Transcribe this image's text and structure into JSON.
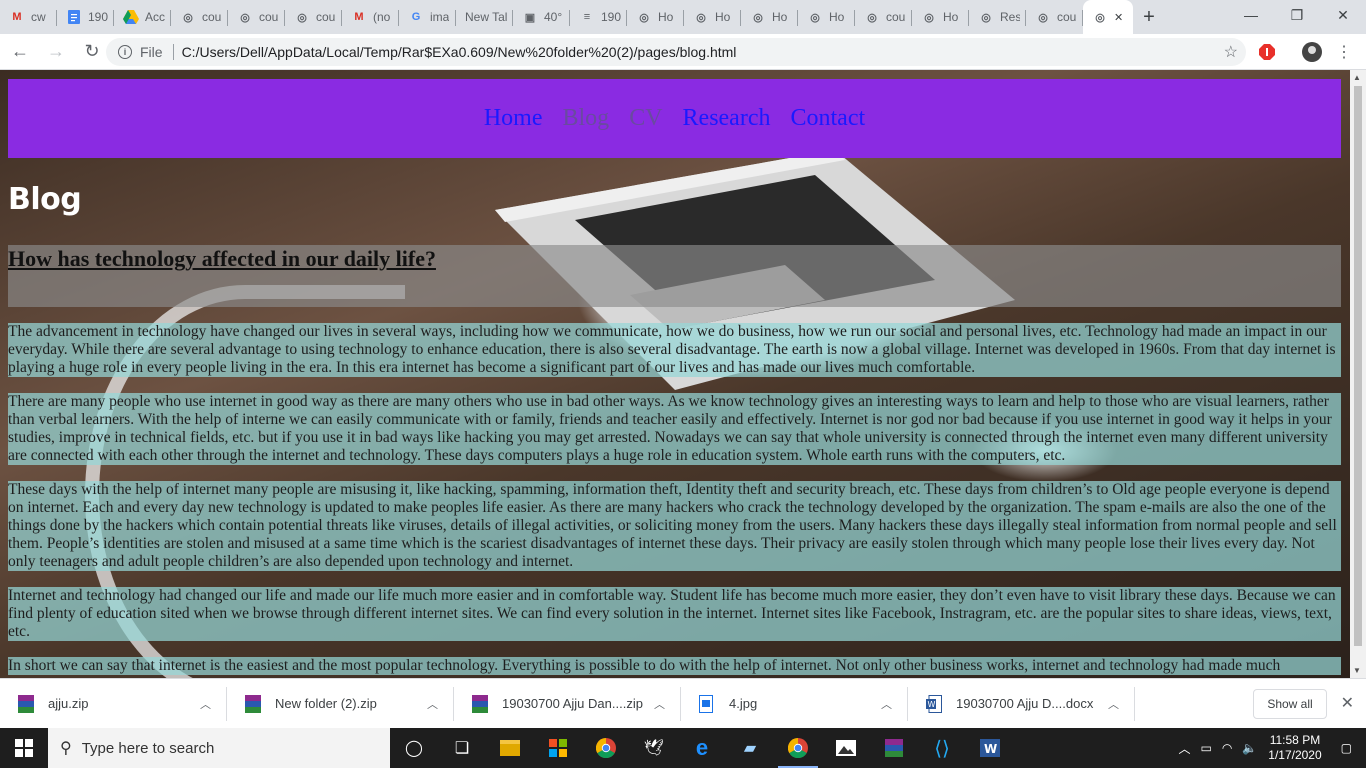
{
  "tabs": [
    {
      "title": "cw",
      "icon": "gmail-icon"
    },
    {
      "title": "190",
      "icon": "docs-icon"
    },
    {
      "title": "Acc",
      "icon": "drive-icon"
    },
    {
      "title": "cou",
      "icon": "globe-icon"
    },
    {
      "title": "cou",
      "icon": "globe-icon"
    },
    {
      "title": "cou",
      "icon": "globe-icon"
    },
    {
      "title": "(no",
      "icon": "gmail-icon"
    },
    {
      "title": "ima",
      "icon": "google-icon"
    },
    {
      "title": "New Tal",
      "icon": "none"
    },
    {
      "title": "40°",
      "icon": "weather-icon"
    },
    {
      "title": "190",
      "icon": "doc-icon"
    },
    {
      "title": "Ho",
      "icon": "globe-icon"
    },
    {
      "title": "Ho",
      "icon": "globe-icon"
    },
    {
      "title": "Ho",
      "icon": "globe-icon"
    },
    {
      "title": "Ho",
      "icon": "globe-icon"
    },
    {
      "title": "cou",
      "icon": "globe-icon"
    },
    {
      "title": "Ho",
      "icon": "globe-icon"
    },
    {
      "title": "Res",
      "icon": "globe-icon"
    },
    {
      "title": "cou",
      "icon": "globe-icon"
    }
  ],
  "address": {
    "scheme_label": "File",
    "url": "C:/Users/Dell/AppData/Local/Temp/Rar$EXa0.609/New%20folder%20(2)/pages/blog.html"
  },
  "page": {
    "nav": [
      {
        "label": "Home",
        "state": "link"
      },
      {
        "label": "Blog",
        "state": "visited"
      },
      {
        "label": "CV",
        "state": "visited"
      },
      {
        "label": "Research",
        "state": "link"
      },
      {
        "label": "Contact",
        "state": "link"
      }
    ],
    "title": "Blog",
    "question": "How has technology affected in our daily life?",
    "paragraphs": [
      "The advancement in technology have changed our lives in several ways, including how we communicate, how we do business, how we run our social and personal lives, etc. Technology had made an impact in our everyday. While there are several advantage to using technology to enhance education, there is also several disadvantage. The earth is now a global village. Internet was developed in 1960s. From that day internet is playing a huge role in every people living in the era. In this era internet has become a significant part of our lives and has made our lives much comfortable.",
      "There are many people who use internet in good way as there are many others who use in bad other ways. As we know technology gives an interesting ways to learn and help to those who are visual learners, rather than verbal learners. With the help of interne we can easily communicate with or family, friends and teacher easily and effectively. Internet is nor god nor bad because if you use internet in good way it helps in your studies, improve in technical fields, etc. but if you use it in bad ways like hacking you may get arrested. Nowadays we can say that whole university is connected through the internet even many different university are connected with each other through the internet and technology. These days computers plays a huge role in education system. Whole earth runs with the computers, etc.",
      "These days with the help of internet many people are misusing it, like hacking, spamming, information theft, Identity theft and security breach, etc. These days from children’s to Old age people everyone is depend on internet. Each and every day new technology is updated to make peoples life easier. As there are many hackers who crack the technology developed by the organization. The spam e-mails are also the one of the things done by the hackers which contain potential threats like viruses, details of illegal activities, or soliciting money from the users. Many hackers these days illegally steal information from normal people and sell them. People’s identities are stolen and misused at a same time which is the scariest disadvantages of internet these days. Their privacy are easily stolen through which many people lose their lives every day. Not only teenagers and adult people children’s are also depended upon technology and internet.",
      "Internet and technology had changed our life and made our life much more easier and in comfortable way. Student life has become much more easier, they don’t even have to visit library these days. Because we can find plenty of education sited when we browse through different internet sites. We can find every solution in the internet. Internet sites like Facebook, Instragram, etc. are the popular sites to share ideas, views, text, etc.",
      "In short we can say that internet is the easiest and the most popular technology. Everything is possible to do with the help of internet. Not only other business works, internet and technology had made much"
    ]
  },
  "downloads": [
    {
      "name": "ajju.zip",
      "icon": "winrar-icon"
    },
    {
      "name": "New folder (2).zip",
      "icon": "winrar-icon"
    },
    {
      "name": "19030700 Ajju Dan....zip",
      "icon": "winrar-icon"
    },
    {
      "name": "4.jpg",
      "icon": "image-file-icon"
    },
    {
      "name": "19030700 Ajju D....docx",
      "icon": "word-file-icon"
    }
  ],
  "show_all_label": "Show all",
  "taskbar": {
    "search_placeholder": "Type here to search",
    "time": "11:58 PM",
    "date": "1/17/2020"
  },
  "colors": {
    "nav_bg": "#8a2be2",
    "link": "#1a1aff",
    "visited": "#6a4aa0",
    "paragraph_bg": "rgba(150,215,215,0.72)"
  }
}
